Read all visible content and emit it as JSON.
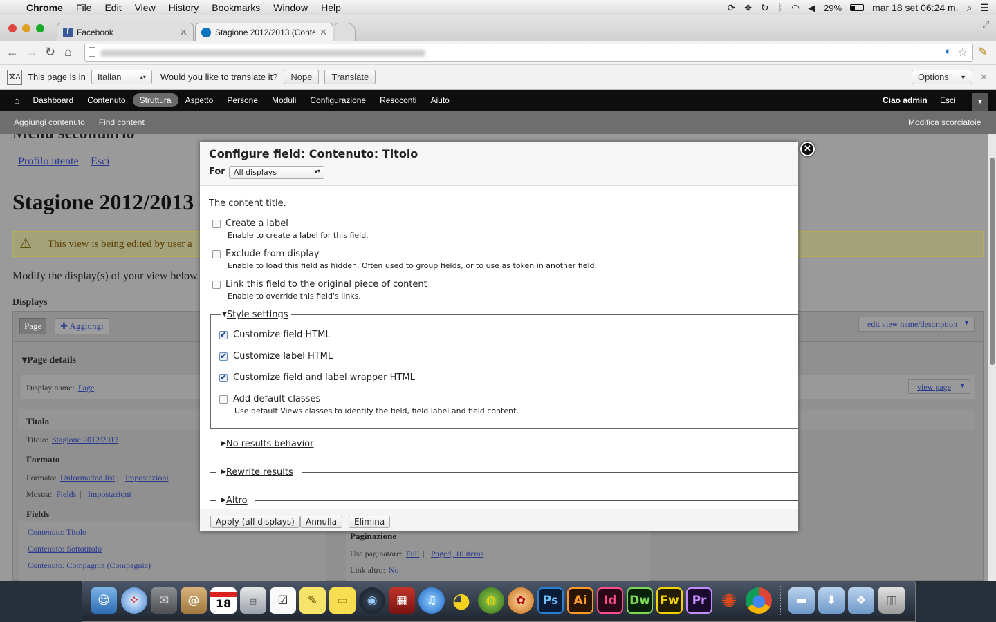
{
  "menubar": {
    "app": "Chrome",
    "items": [
      "File",
      "Edit",
      "View",
      "History",
      "Bookmarks",
      "Window",
      "Help"
    ],
    "battery": "29%",
    "clock": "mar 18 set  06:24 m."
  },
  "tabs": [
    {
      "title": "Facebook",
      "favicon_color": "#3b5998"
    },
    {
      "title": "Stagione 2012/2013 (Conter",
      "favicon_color": "#0a75bd"
    }
  ],
  "translate_bar": {
    "prefix": "This page is in",
    "language": "Italian",
    "question": "Would you like to translate it?",
    "nope": "Nope",
    "translate": "Translate",
    "options": "Options"
  },
  "admin_toolbar": {
    "items": [
      "Dashboard",
      "Contenuto",
      "Struttura",
      "Aspetto",
      "Persone",
      "Moduli",
      "Configurazione",
      "Resoconti",
      "Aiuto"
    ],
    "active": "Struttura",
    "greeting": "Ciao admin",
    "logout": "Esci"
  },
  "shortcuts": {
    "items": [
      "Aggiungi contenuto",
      "Find content"
    ],
    "edit": "Modifica scorciatoie"
  },
  "page": {
    "menu_heading": "Menu secondario",
    "user_links": [
      "Profilo utente",
      "Esci"
    ],
    "title": "Stagione 2012/2013",
    "warning": "This view is being edited by user a",
    "modify_text": "Modify the display(s) of your view below o",
    "displays_heading": "Displays",
    "display_tab": "Page",
    "add_button": "Aggiungi",
    "edit_view_name": "edit view name/description",
    "page_details": "Page details",
    "display_name_label": "Display name:",
    "display_name_value": "Page",
    "view_page": "view page",
    "titolo_heading": "Titolo",
    "titolo_label": "Titolo:",
    "titolo_value": "Stagione 2012/2013",
    "formato_heading": "Formato",
    "formato_label": "Formato:",
    "formato_value": "Unformatted list",
    "formato_settings": "Impostazioni",
    "mostra_label": "Mostra:",
    "mostra_value": "Fields",
    "mostra_settings": "Impostazioni",
    "fields_heading": "Fields",
    "fields": [
      "Contenuto: Titolo",
      "Contenuto: Sottotitolo",
      "Contenuto: Compagnia (Compagnia)"
    ],
    "paginazione_heading": "Paginazione",
    "pager_label": "Usa paginatore:",
    "pager_value": "Full",
    "pager_items": "Paged, 10 items",
    "link_altro_label": "Link altro:",
    "link_altro_value": "No"
  },
  "modal": {
    "title": "Configure field: Contenuto: Titolo",
    "for_label": "For",
    "for_value": "All displays",
    "intro": "The content title.",
    "options": [
      {
        "label": "Create a label",
        "desc": "Enable to create a label for this field.",
        "checked": false
      },
      {
        "label": "Exclude from display",
        "desc": "Enable to load this field as hidden. Often used to group fields, or to use as token in another field.",
        "checked": false
      },
      {
        "label": "Link this field to the original piece of content",
        "desc": "Enable to override this field's links.",
        "checked": false
      }
    ],
    "style_settings": {
      "legend": "Style settings",
      "options": [
        {
          "label": "Customize field HTML",
          "checked": true
        },
        {
          "label": "Customize label HTML",
          "checked": true
        },
        {
          "label": "Customize field and label wrapper HTML",
          "checked": true
        },
        {
          "label": "Add default classes",
          "desc": "Use default Views classes to identify the field, field label and field content.",
          "checked": false
        }
      ]
    },
    "collapsed_sections": [
      "No results behavior",
      "Rewrite results",
      "Altro"
    ],
    "buttons": {
      "apply": "Apply (all displays)",
      "cancel": "Annulla",
      "remove": "Elimina"
    }
  },
  "dock": {
    "calendar_day": "18",
    "apps": [
      "Ps",
      "Ai",
      "Id",
      "Dw",
      "Fw",
      "Pr"
    ]
  }
}
